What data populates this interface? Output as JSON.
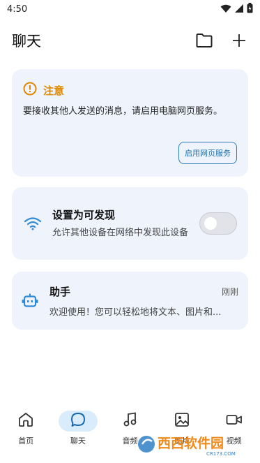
{
  "status_bar": {
    "time": "4:50",
    "icons": [
      "wifi-icon",
      "signal-icon",
      "battery-icon"
    ]
  },
  "app_bar": {
    "title": "聊天",
    "actions": [
      "folder-icon",
      "plus-icon"
    ]
  },
  "notice": {
    "icon": "warning-circle-icon",
    "title": "注意",
    "text": "要接收其他人发送的消息，请启用电脑网页服务。",
    "button_label": "启用网页服务",
    "accent": "#e08a00",
    "button_color": "#2d7fb6"
  },
  "discover": {
    "icon": "wifi-icon",
    "title": "设置为可发现",
    "description": "允许其他设备在网络中发现此设备",
    "toggle_on": false
  },
  "chat": {
    "icon": "robot-icon",
    "name": "助手",
    "time": "刚刚",
    "preview": "欢迎使用！您可以轻松地将文本、图片和..."
  },
  "bottom_nav": {
    "items": [
      {
        "label": "首页",
        "icon": "home-icon",
        "active": false
      },
      {
        "label": "聊天",
        "icon": "chat-bubble-icon",
        "active": true
      },
      {
        "label": "音频",
        "icon": "music-icon",
        "active": false
      },
      {
        "label": "图片",
        "icon": "image-icon",
        "active": false
      },
      {
        "label": "视频",
        "icon": "video-icon",
        "active": false
      }
    ]
  },
  "watermark": {
    "text": "西西软件园",
    "sub": "CR173.COM"
  },
  "colors": {
    "card_bg": "#eef3fc",
    "primary": "#2e8ad8",
    "active_pill": "#d9ecfb"
  }
}
